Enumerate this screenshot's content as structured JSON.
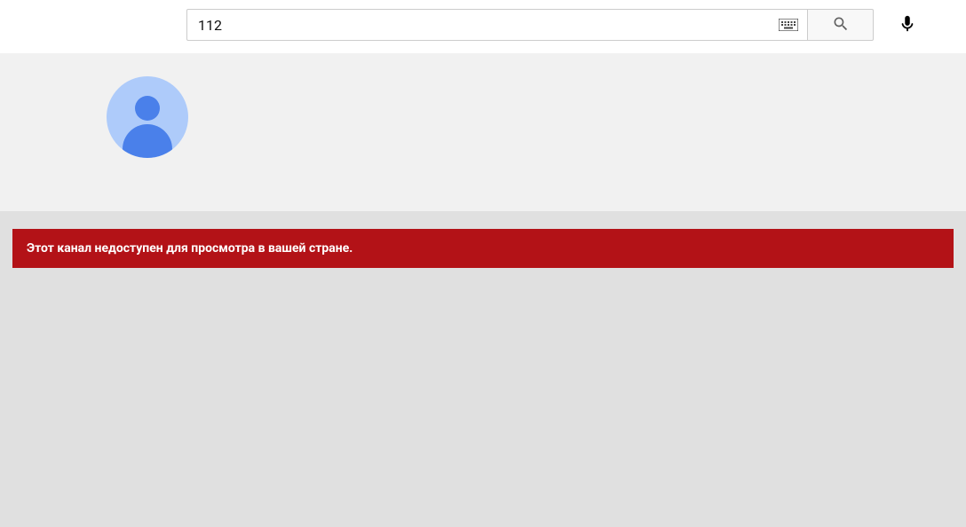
{
  "header": {
    "search": {
      "value": "112",
      "placeholder": ""
    }
  },
  "alert": {
    "message": "Этот канал недоступен для просмотра в вашей стране."
  }
}
